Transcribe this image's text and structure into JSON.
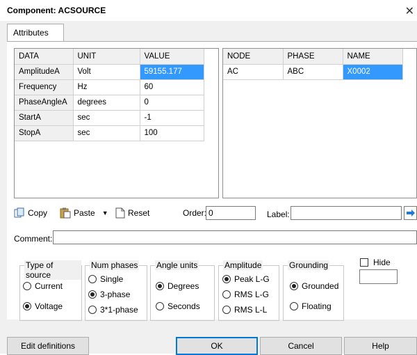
{
  "window": {
    "title": "Component: ACSOURCE",
    "close_glyph": "✕"
  },
  "tabs": [
    {
      "label": "Attributes"
    }
  ],
  "data_grid": {
    "columns": [
      "DATA",
      "UNIT",
      "VALUE"
    ],
    "rows": [
      {
        "data": "AmplitudeA",
        "unit": "Volt",
        "value": "59155.177"
      },
      {
        "data": "Frequency",
        "unit": "Hz",
        "value": "60"
      },
      {
        "data": "PhaseAngleA",
        "unit": "degrees",
        "value": "0"
      },
      {
        "data": "StartA",
        "unit": "sec",
        "value": "-1"
      },
      {
        "data": "StopA",
        "unit": "sec",
        "value": "100"
      }
    ]
  },
  "node_grid": {
    "columns": [
      "NODE",
      "PHASE",
      "NAME"
    ],
    "rows": [
      {
        "node": "AC",
        "phase": "ABC",
        "name": "X0002"
      }
    ]
  },
  "toolbar": {
    "copy": "Copy",
    "paste": "Paste",
    "reset": "Reset",
    "order_label": "Order:",
    "order_value": "0",
    "label_label": "Label:",
    "label_value": ""
  },
  "comment": {
    "label": "Comment:",
    "value": ""
  },
  "groups": {
    "type_of_source": {
      "title": "Type of source",
      "options": [
        "Current",
        "Voltage"
      ],
      "selected": "Voltage"
    },
    "num_phases": {
      "title": "Num phases",
      "options": [
        "Single",
        "3-phase",
        "3*1-phase"
      ],
      "selected": "3-phase"
    },
    "angle_units": {
      "title": "Angle units",
      "options": [
        "Degrees",
        "Seconds"
      ],
      "selected": "Degrees"
    },
    "amplitude": {
      "title": "Amplitude",
      "options": [
        "Peak L-G",
        "RMS L-G",
        "RMS L-L"
      ],
      "selected": "Peak L-G"
    },
    "grounding": {
      "title": "Grounding",
      "options": [
        "Grounded",
        "Floating"
      ],
      "selected": "Grounded"
    }
  },
  "hide": {
    "label": "Hide",
    "checked": false,
    "value": ""
  },
  "buttons": {
    "edit": "Edit definitions",
    "ok": "OK",
    "cancel": "Cancel",
    "help": "Help"
  },
  "colors": {
    "selection": "#3399ff",
    "default_button_border": "#0078d7",
    "arrow_blue": "#1f7ad6"
  }
}
